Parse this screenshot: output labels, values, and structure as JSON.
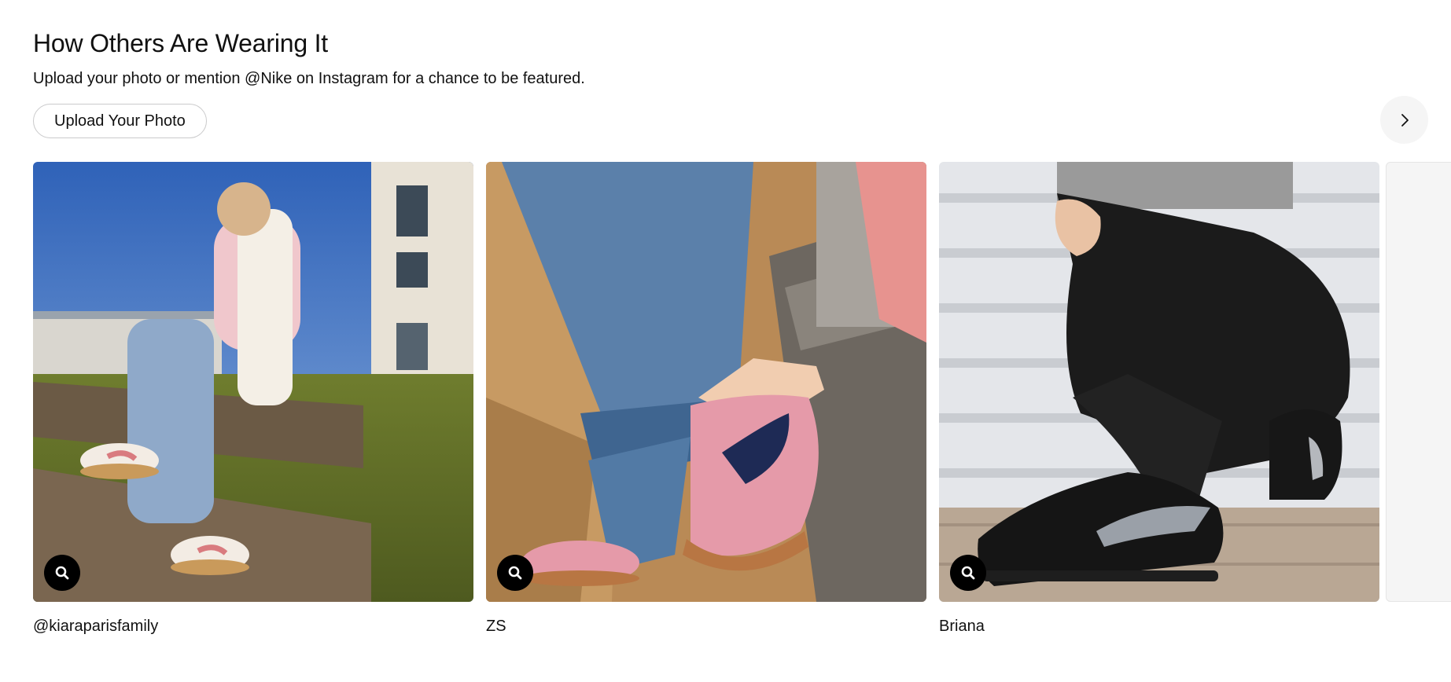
{
  "section": {
    "title": "How Others Are Wearing It",
    "subtitle": "Upload your photo or mention @Nike on Instagram for a chance to be featured.",
    "upload_button_label": "Upload Your Photo",
    "next_icon": "chevron-right-icon",
    "zoom_icon": "search-icon"
  },
  "cards": [
    {
      "caption": "@kiaraparisfamily"
    },
    {
      "caption": "ZS"
    },
    {
      "caption": "Briana"
    }
  ],
  "colors": {
    "text": "#111111",
    "button_border": "#cacacb",
    "nav_button_bg": "#f5f5f5",
    "zoom_button_bg": "#000000"
  }
}
